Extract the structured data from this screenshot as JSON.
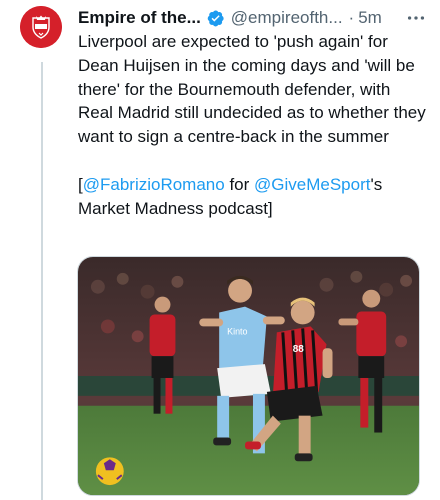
{
  "author": {
    "name": "Empire of the...",
    "handle": "@empireofth...",
    "separator": "·",
    "time": "5m",
    "verified": true,
    "avatar_icon": "empire-of-the-kop-crest-icon",
    "avatar_color": "#d5202a"
  },
  "tweet": {
    "paragraph1": "Liverpool are expected to 'push again' for Dean Huijsen in the coming days and 'will be there' for the Bournemouth defender, with Real Madrid still undecided as to whether they want to sign a centre-back in the summer",
    "paragraph2": {
      "open_bracket": "[",
      "mention1": "@FabrizioRomano",
      "for_word": " for ",
      "mention2": "@GiveMeSport",
      "suffix": "'s Market Madness podcast]"
    }
  },
  "media": {
    "kind": "photo",
    "description_icon": "football-match-photo",
    "jersey_text": "Kinto",
    "opponent_number": "88"
  },
  "colors": {
    "link": "#1d9bf0",
    "secondary_text": "#536471",
    "verified_badge": "#1d9bf0"
  },
  "icons": {
    "verified": "verified-badge-icon",
    "more": "more-horizontal-icon"
  }
}
